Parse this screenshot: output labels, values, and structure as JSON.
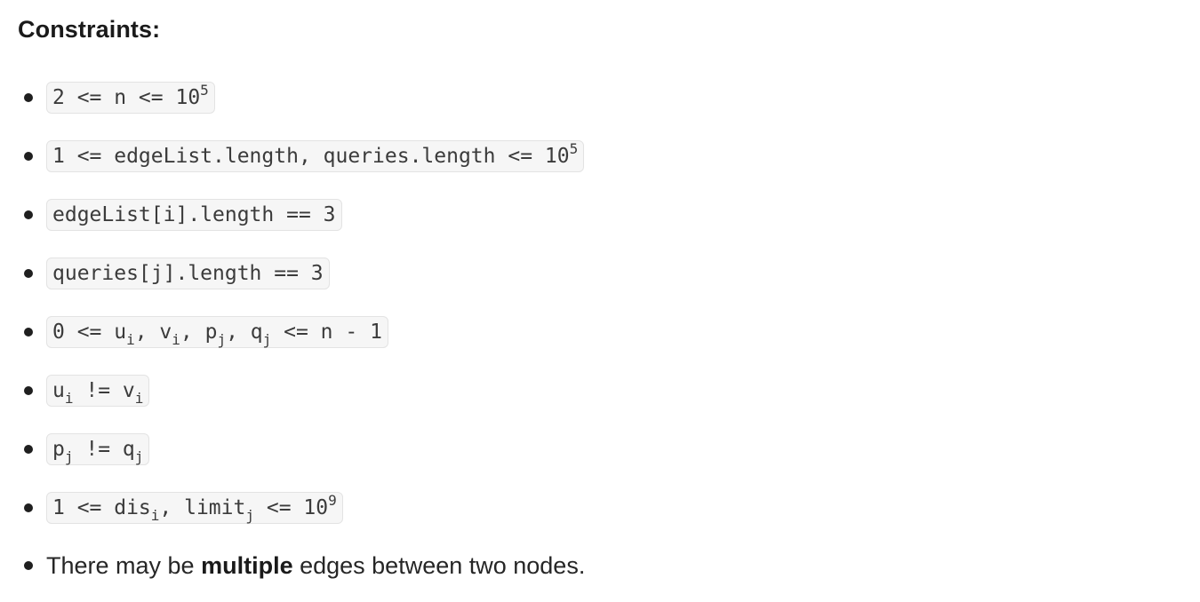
{
  "heading": "Constraints:",
  "items": [
    {
      "segments": [
        {
          "text": "2 <= n <= 10",
          "style": "normal"
        },
        {
          "text": "5",
          "style": "sup"
        }
      ]
    },
    {
      "segments": [
        {
          "text": "1 <= edgeList.length, queries.length <= 10",
          "style": "normal"
        },
        {
          "text": "5",
          "style": "sup"
        }
      ]
    },
    {
      "segments": [
        {
          "text": "edgeList[i].length == 3",
          "style": "normal"
        }
      ]
    },
    {
      "segments": [
        {
          "text": "queries[j].length == 3",
          "style": "normal"
        }
      ]
    },
    {
      "segments": [
        {
          "text": "0 <= u",
          "style": "normal"
        },
        {
          "text": "i",
          "style": "sub"
        },
        {
          "text": ", v",
          "style": "normal"
        },
        {
          "text": "i",
          "style": "sub"
        },
        {
          "text": ", p",
          "style": "normal"
        },
        {
          "text": "j",
          "style": "sub"
        },
        {
          "text": ", q",
          "style": "normal"
        },
        {
          "text": "j",
          "style": "sub"
        },
        {
          "text": " <= n - 1",
          "style": "normal"
        }
      ]
    },
    {
      "segments": [
        {
          "text": "u",
          "style": "normal"
        },
        {
          "text": "i",
          "style": "sub"
        },
        {
          "text": " != v",
          "style": "normal"
        },
        {
          "text": "i",
          "style": "sub"
        }
      ]
    },
    {
      "segments": [
        {
          "text": "p",
          "style": "normal"
        },
        {
          "text": "j",
          "style": "sub"
        },
        {
          "text": " != q",
          "style": "normal"
        },
        {
          "text": "j",
          "style": "sub"
        }
      ]
    },
    {
      "segments": [
        {
          "text": "1 <= dis",
          "style": "normal"
        },
        {
          "text": "i",
          "style": "sub"
        },
        {
          "text": ", limit",
          "style": "normal"
        },
        {
          "text": "j",
          "style": "sub"
        },
        {
          "text": " <= 10",
          "style": "normal"
        },
        {
          "text": "9",
          "style": "sup"
        }
      ]
    }
  ],
  "note": {
    "before": "There may be ",
    "bold": "multiple",
    "after": " edges between two nodes."
  }
}
